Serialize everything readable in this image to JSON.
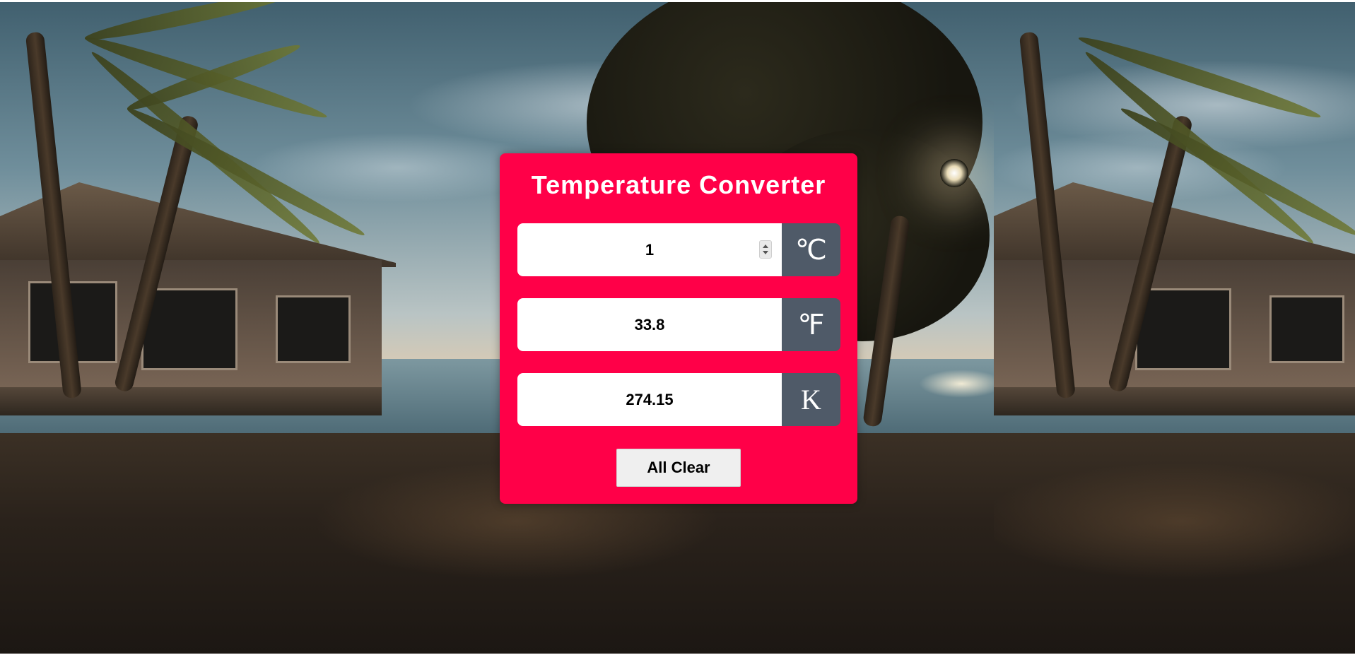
{
  "converter": {
    "title": "Temperature Converter",
    "celsius": {
      "value": "1",
      "unit_symbol": "℃"
    },
    "fahrenheit": {
      "value": "33.8",
      "unit_symbol": "℉"
    },
    "kelvin": {
      "value": "274.15",
      "unit_symbol": "K"
    },
    "clear_label": "All Clear"
  },
  "colors": {
    "card": "#ff0048",
    "unit_badge": "#4f5a68",
    "button": "#efefef"
  },
  "icons": {
    "number_spinner": "spinner-arrows-icon"
  }
}
